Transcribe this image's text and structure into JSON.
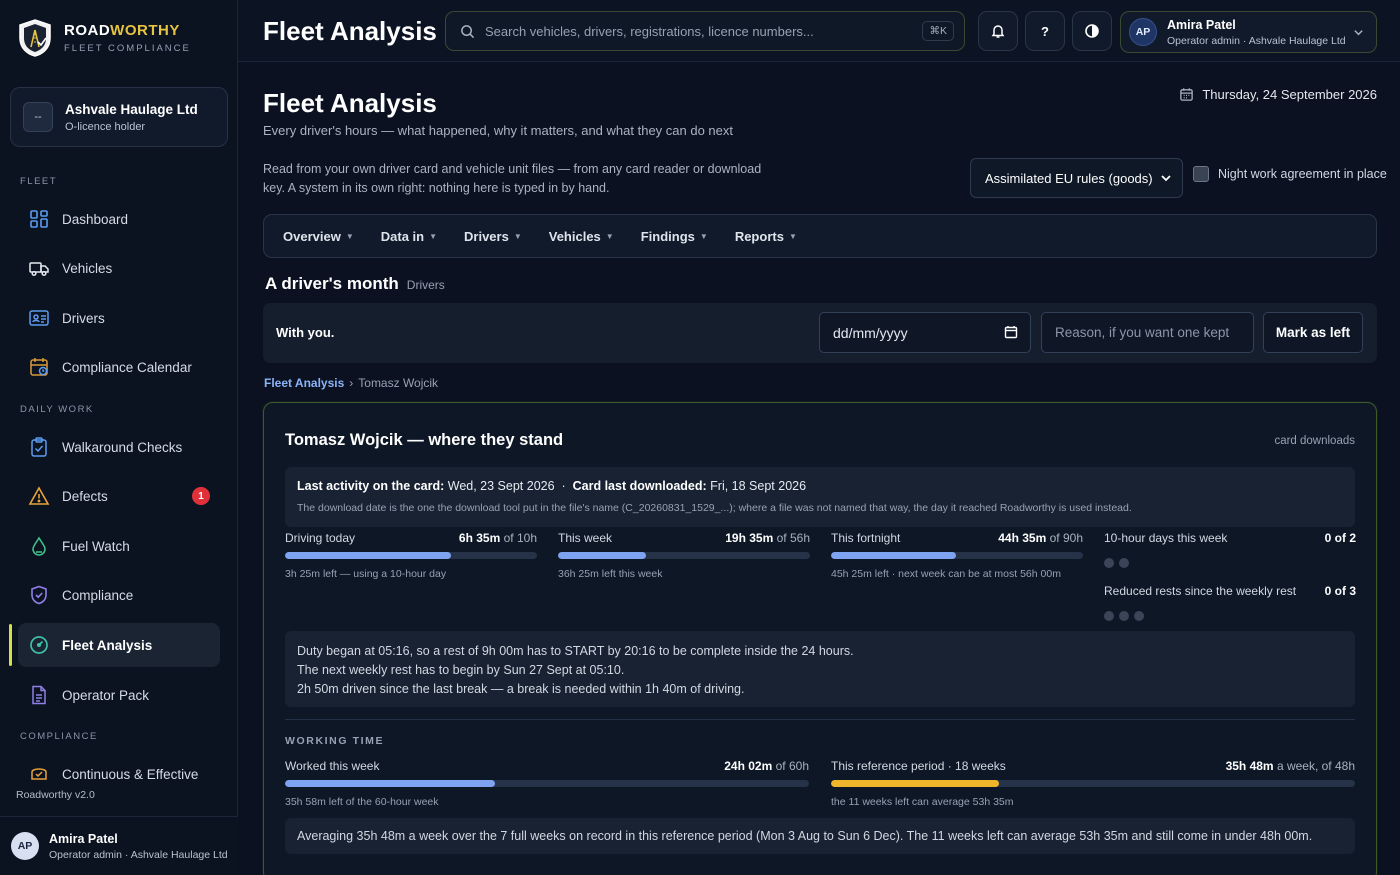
{
  "brand": {
    "name_part1": "ROAD",
    "name_part2": "WORTHY",
    "subtitle": "FLEET COMPLIANCE"
  },
  "org": {
    "badge": "--",
    "name": "Ashvale Haulage Ltd",
    "role": "O-licence holder"
  },
  "nav": {
    "sections": {
      "fleet": "FLEET",
      "daily": "DAILY WORK",
      "compliance": "COMPLIANCE"
    },
    "items": [
      {
        "label": "Dashboard",
        "icon": "dashboard-icon"
      },
      {
        "label": "Vehicles",
        "icon": "truck-icon"
      },
      {
        "label": "Drivers",
        "icon": "id-card-icon"
      },
      {
        "label": "Compliance Calendar",
        "icon": "calendar-icon"
      },
      {
        "label": "Walkaround Checks",
        "icon": "clipboard-check-icon"
      },
      {
        "label": "Defects",
        "icon": "warning-icon",
        "badge": "1"
      },
      {
        "label": "Fuel Watch",
        "icon": "fuel-drop-icon"
      },
      {
        "label": "Compliance",
        "icon": "shield-check-icon"
      },
      {
        "label": "Fleet Analysis",
        "icon": "gauge-icon",
        "active": true
      },
      {
        "label": "Operator Pack",
        "icon": "document-icon"
      },
      {
        "label": "Continuous & Effective",
        "icon": "badge-icon"
      }
    ]
  },
  "version": "Roadworthy v2.0",
  "user": {
    "initials": "AP",
    "name": "Amira Patel",
    "role": "Operator admin · Ashvale Haulage Ltd"
  },
  "topbar": {
    "title": "Fleet Analysis",
    "search_placeholder": "Search vehicles, drivers, registrations, licence numbers...",
    "shortcut": "⌘K",
    "help": "?"
  },
  "page": {
    "title": "Fleet Analysis",
    "subtitle": "Every driver's hours — what happened, why it matters, and what they can do next",
    "date": "Thursday, 24 September 2026",
    "intro": "Read from your own driver card and vehicle unit files — from any card reader or download key. A system in its own right: nothing here is typed in by hand.",
    "rules_select": "Assimilated EU rules (goods)",
    "night_label": "Night work agreement in place",
    "tabs": [
      "Overview",
      "Data in",
      "Drivers",
      "Vehicles",
      "Findings",
      "Reports"
    ]
  },
  "month": {
    "title": "A driver's month",
    "tag": "Drivers",
    "with_you": "With you.",
    "date_placeholder": "dd/mm/yyyy",
    "reason_placeholder": "Reason, if you want one kept",
    "mark_left": "Mark as left"
  },
  "breadcrumb": {
    "root": "Fleet Analysis",
    "sep": "›",
    "current": "Tomasz Wojcik"
  },
  "stand": {
    "title": "Tomasz Wojcik — where they stand",
    "tag": "card downloads",
    "activity_label": "Last activity on the card:",
    "activity_value": "Wed, 23 Sept 2026",
    "sep": "·",
    "download_label": "Card last downloaded:",
    "download_value": "Fri, 18 Sept 2026",
    "note": "The download date is the one the download tool put in the file's name (C_20260831_1529_...); where a file was not named that way, the day it reached Roadworthy is used instead.",
    "driving": [
      {
        "label": "Driving today",
        "value": "6h 35m",
        "of": "of 10h",
        "progress": 0.658,
        "note": "3h 25m left — using a 10-hour day"
      },
      {
        "label": "This week",
        "value": "19h 35m",
        "of": "of 56h",
        "progress": 0.35,
        "note": "36h 25m left this week"
      },
      {
        "label": "This fortnight",
        "value": "44h 35m",
        "of": "of 90h",
        "progress": 0.495,
        "note": "45h 25m left · next week can be at most 56h 00m"
      }
    ],
    "counters": [
      {
        "label": "10-hour days this week",
        "value": "0 of 2",
        "used": 0,
        "total": 2
      },
      {
        "label": "Reduced rests since the weekly rest",
        "value": "0 of 3",
        "used": 0,
        "total": 3
      }
    ],
    "duty_lines": [
      "Duty began at 05:16, so a rest of 9h 00m has to START by 20:16 to be complete inside the 24 hours.",
      "The next weekly rest has to begin by Sun 27 Sept at 05:10.",
      "2h 50m driven since the last break — a break is needed within 1h 40m of driving."
    ],
    "working_time": {
      "label": "WORKING TIME",
      "worked": {
        "label": "Worked this week",
        "value": "24h 02m",
        "of": "of 60h",
        "progress": 0.4,
        "note": "35h 58m left of the 60-hour week"
      },
      "reference": {
        "label": "This reference period · 18 weeks",
        "value": "35h 48m",
        "of": "a week, of 48h",
        "progress": 0.32,
        "note": "the 11 weeks left can average 53h 35m"
      },
      "average": "Averaging 35h 48m a week over the 7 full weeks on record in this reference period (Mon 3 Aug to Sun 6 Dec). The 11 weeks left can average 53h 35m and still come in under 48h 00m."
    }
  },
  "colors": {
    "accent": "#d4e04a",
    "brand_yellow": "#e6c341",
    "bar": "#7ea3f0",
    "amber": "#efb62c",
    "danger": "#e0313b"
  }
}
